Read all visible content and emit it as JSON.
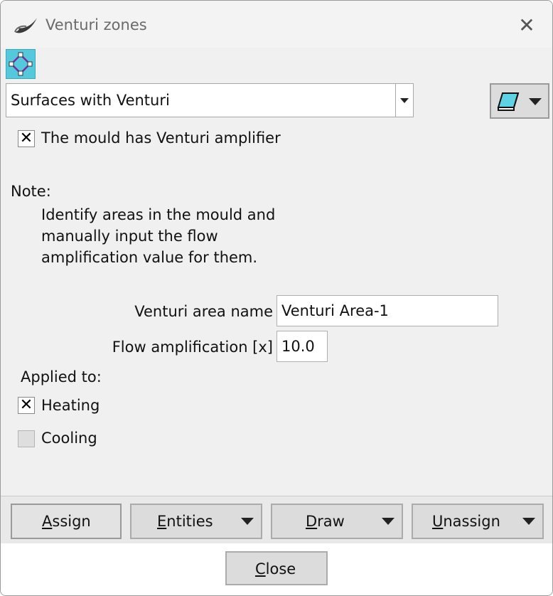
{
  "window": {
    "title": "Venturi zones",
    "close_icon": "close-icon",
    "app_icon": "app-logo-icon"
  },
  "toolbar": {
    "surface_select_icon": "surface-select-icon"
  },
  "surface_combo": {
    "value": "Surfaces with Venturi",
    "dropdown_icon": "chevron-down-icon"
  },
  "layer_button": {
    "icon": "layer-icon",
    "dropdown_icon": "chevron-down-icon"
  },
  "amplifier_checkbox": {
    "checked": true,
    "label": "The mould has Venturi amplifier"
  },
  "note": {
    "heading": "Note:",
    "lines": [
      "Identify areas in the mould and",
      "manually input the flow",
      "amplification value for them."
    ]
  },
  "form": {
    "area_name_label": "Venturi area name",
    "area_name_value": "Venturi Area-1",
    "flow_amp_label": "Flow amplification [x]",
    "flow_amp_value": "10.0"
  },
  "applied_to": {
    "heading": "Applied to:",
    "heating": {
      "checked": true,
      "label": "Heating"
    },
    "cooling": {
      "checked": false,
      "label": "Cooling"
    }
  },
  "action_buttons": {
    "assign": {
      "first": "A",
      "rest": "ssign"
    },
    "entities": {
      "first": "E",
      "rest": "ntities"
    },
    "draw": {
      "first": "D",
      "rest": "raw"
    },
    "unassign": {
      "first": "U",
      "rest": "nassign"
    }
  },
  "close_button": {
    "first": "C",
    "rest": "lose"
  },
  "colors": {
    "accent_icon_bg": "#55c8dc",
    "button_bg": "#dcdcdc",
    "panel_bg": "#f0f0f0"
  }
}
